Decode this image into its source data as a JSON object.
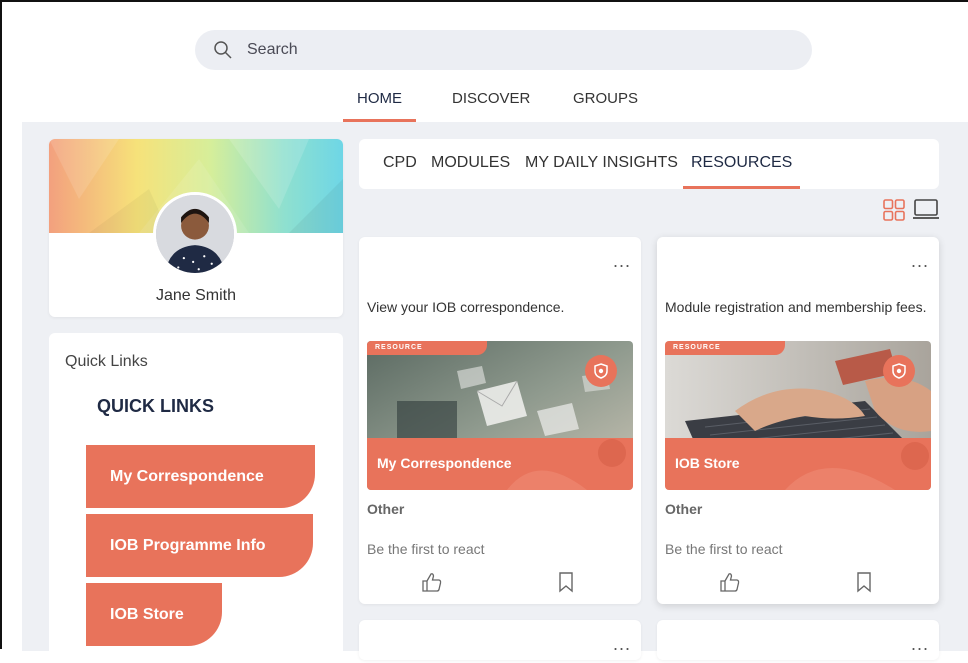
{
  "search": {
    "placeholder": "Search",
    "icon": "search-icon"
  },
  "nav": {
    "tabs": [
      {
        "label": "HOME",
        "active": true
      },
      {
        "label": "DISCOVER",
        "active": false
      },
      {
        "label": "GROUPS",
        "active": false
      }
    ]
  },
  "profile": {
    "name": "Jane Smith"
  },
  "quick_links": {
    "title": "Quick Links",
    "heading": "QUICK LINKS",
    "buttons": [
      "My Correspondence",
      "IOB Programme Info",
      "IOB Store"
    ]
  },
  "subtabs": [
    {
      "label": "CPD",
      "active": false
    },
    {
      "label": "MODULES",
      "active": false
    },
    {
      "label": "MY DAILY INSIGHTS",
      "active": false
    },
    {
      "label": "RESOURCES",
      "active": true
    }
  ],
  "view_icons": [
    "grid-view-icon",
    "list-view-icon"
  ],
  "cards": [
    {
      "description": "View your IOB correspondence.",
      "tag": "RESOURCE",
      "media_title": "My Correspondence",
      "category": "Other",
      "reaction_prompt": "Be the first to react"
    },
    {
      "description": "Module registration and membership fees.",
      "tag": "RESOURCE",
      "media_title": "IOB Store",
      "category": "Other",
      "reaction_prompt": "Be the first to react"
    }
  ],
  "more_menu": "...",
  "colors": {
    "accent": "#e8735b",
    "background": "#eef0f4",
    "heading": "#1f2a44"
  }
}
